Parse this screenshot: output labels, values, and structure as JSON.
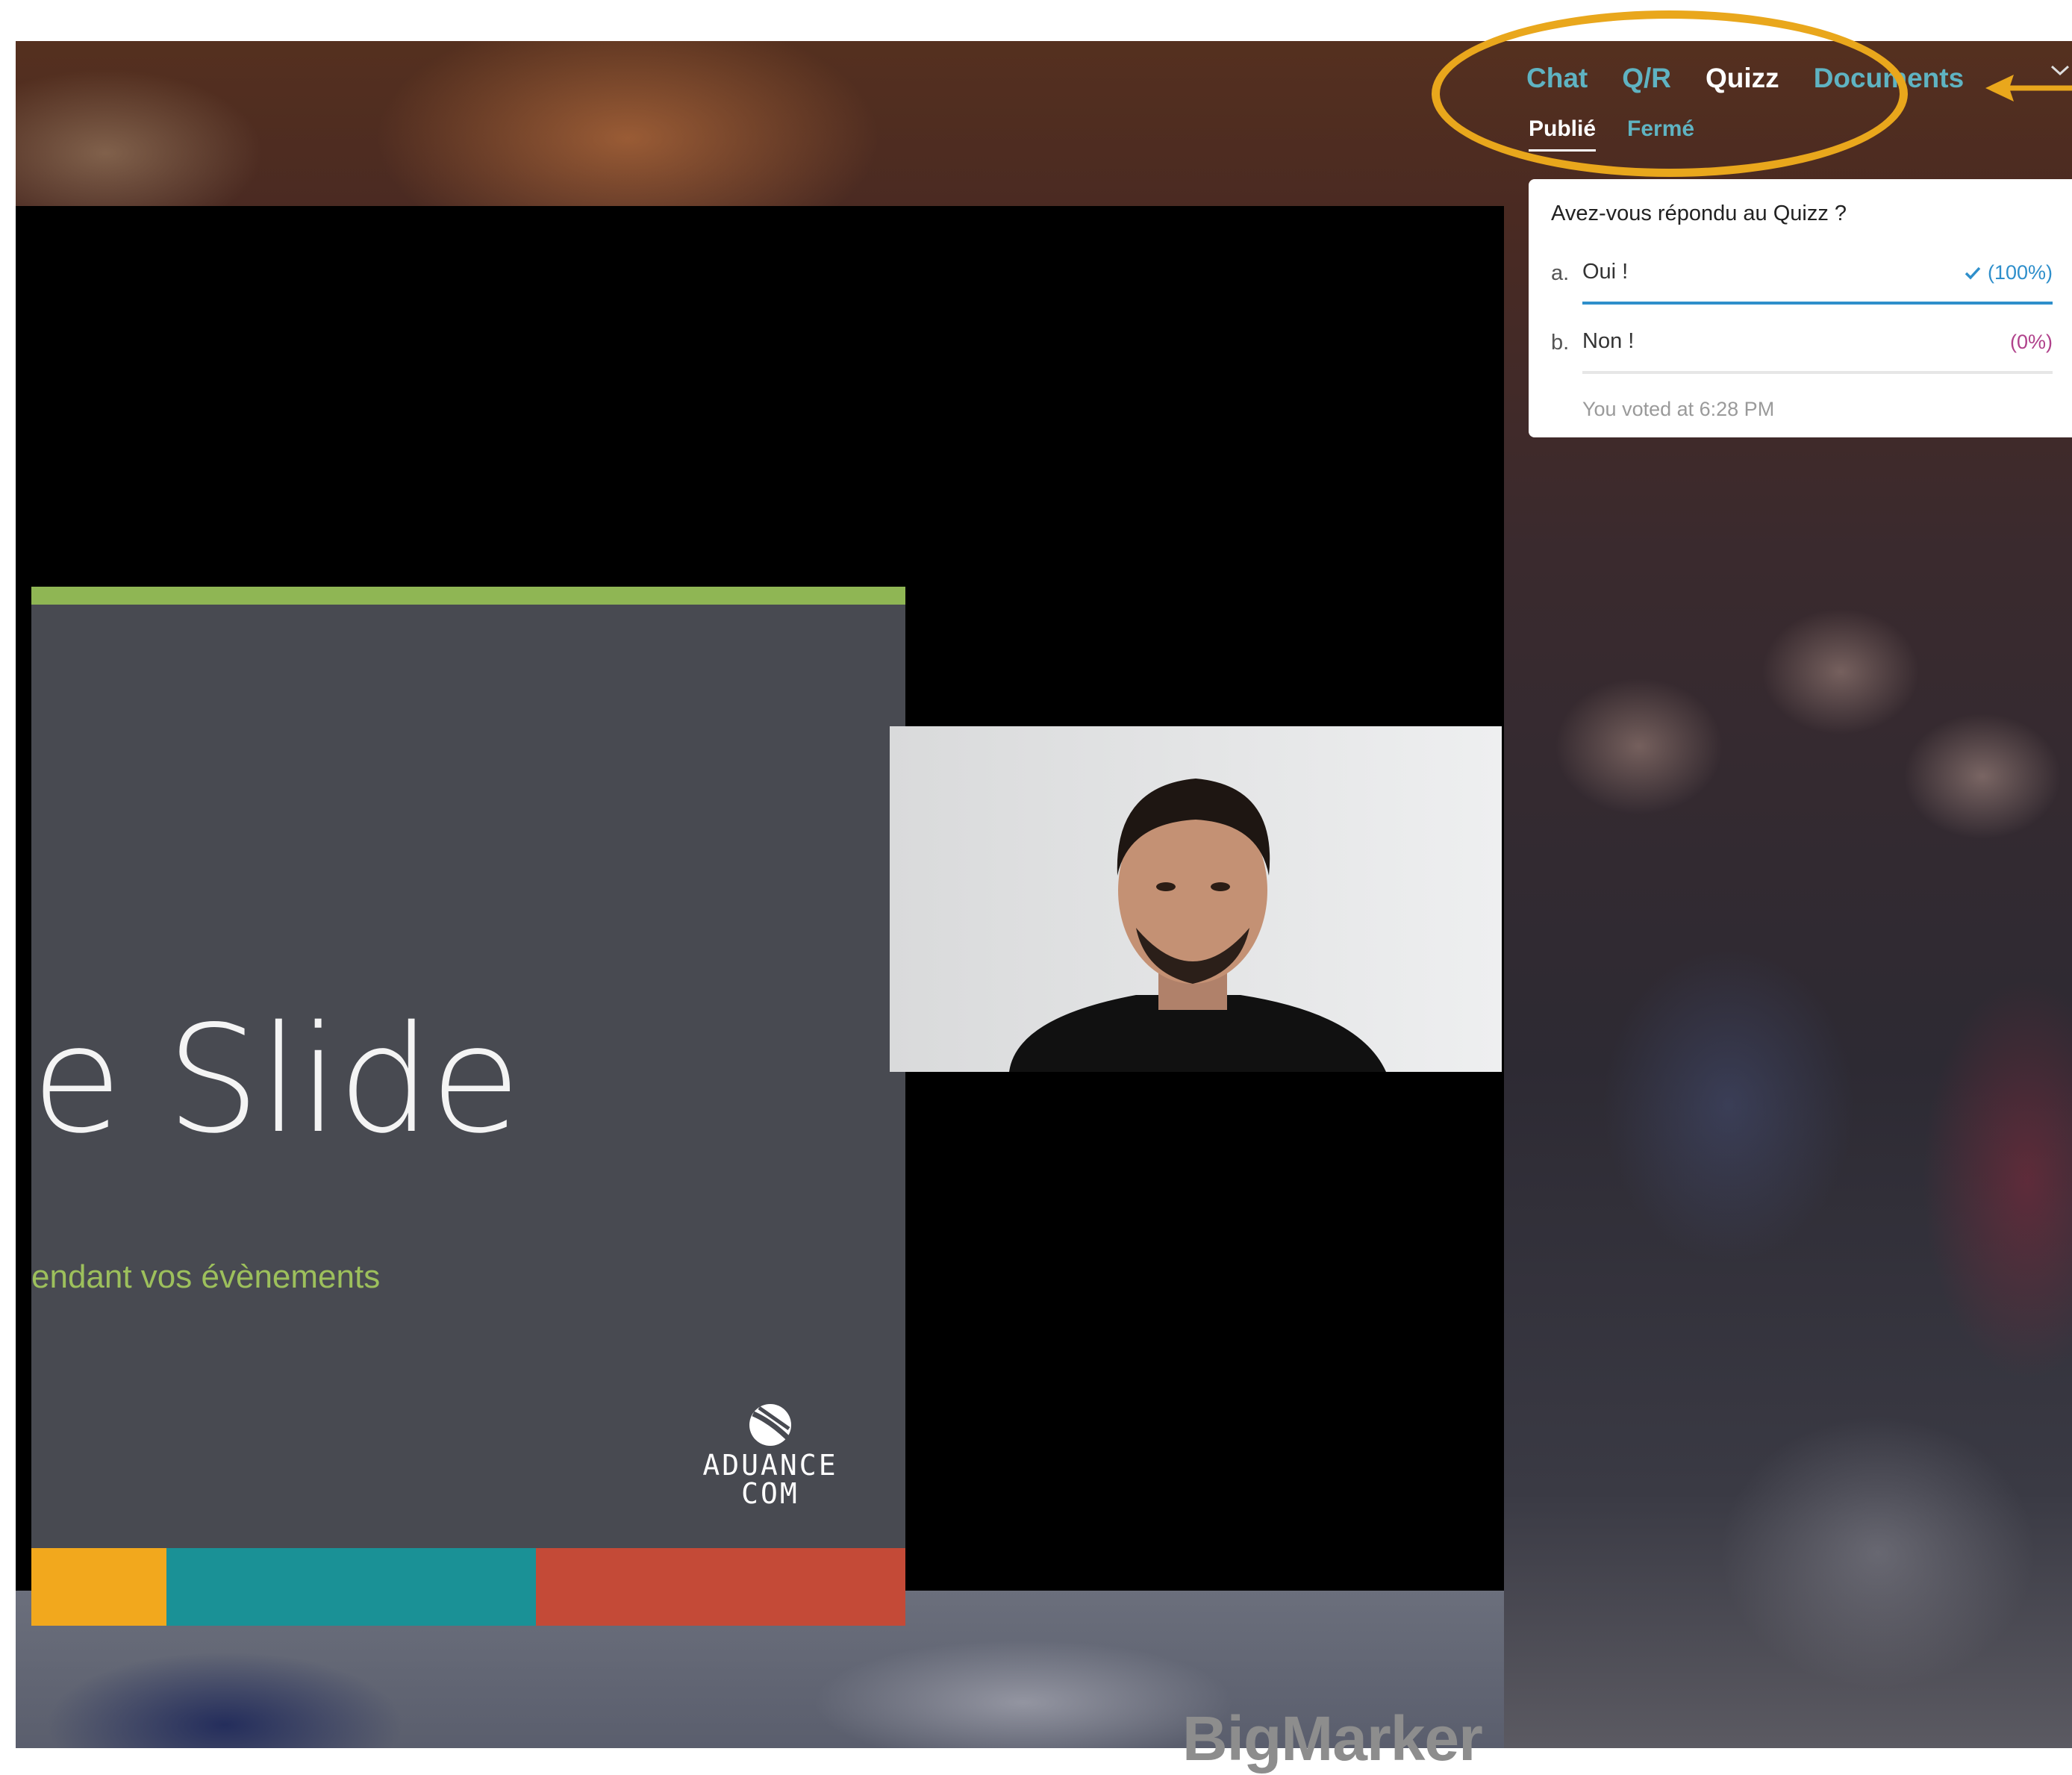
{
  "panel": {
    "tabs": [
      {
        "label": "Chat",
        "active": false
      },
      {
        "label": "Q/R",
        "active": false
      },
      {
        "label": "Quizz",
        "active": true
      },
      {
        "label": "Documents",
        "active": false
      }
    ],
    "subtabs": [
      {
        "label": "Publié",
        "active": true
      },
      {
        "label": "Fermé",
        "active": false
      }
    ],
    "chevron_icon": "chevron-down-icon"
  },
  "quiz": {
    "question": "Avez-vous répondu au Quizz ?",
    "options": [
      {
        "letter": "a.",
        "label": "Oui !",
        "percent_label": "(100%)",
        "fraction": 1.0,
        "selected": true,
        "color": "#2f8fcb",
        "icon": "check-icon"
      },
      {
        "letter": "b.",
        "label": "Non !",
        "percent_label": "(0%)",
        "fraction": 0.0,
        "selected": false,
        "color": "#b0418b"
      }
    ],
    "voted_text": "You voted at 6:28 PM"
  },
  "slide": {
    "title": "e Slide",
    "subtitle": "endant vos évènements",
    "logo_lines": [
      "ADUANCE",
      "COM"
    ],
    "top_bar_color": "#8fb654",
    "color_bar": [
      "#f2a81d",
      "#1a9196",
      "#c44a37"
    ]
  },
  "brand": "BigMarker",
  "annotation": {
    "color": "#e9a71c"
  }
}
